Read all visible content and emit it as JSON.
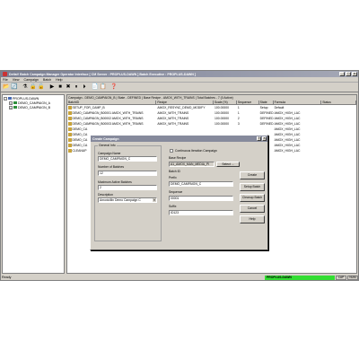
{
  "window": {
    "title": "DeltaV Batch Campaign Manager Operator Interface [ CM Server : PROPLUS-DAWN ] Batch Executive : PROPLUS-DAWN ]",
    "controls": [
      "_",
      "□",
      "×"
    ]
  },
  "menu": [
    "File",
    "View",
    "Campaign",
    "Batch",
    "Help"
  ],
  "toolbar": [
    "open-icon",
    "refresh-icon",
    "batch-icon",
    "lock-icon",
    "unlock-icon",
    "start-icon",
    "stop-icon",
    "cancel-icon",
    "pause-icon",
    "resume-icon",
    "copy-icon",
    "paste-icon",
    "help-icon"
  ],
  "tree": {
    "root": "PROPLUS-DAWN",
    "children": [
      "DEMO_CAMPAIGN_A",
      "DEMO_CAMPAIGN_B"
    ]
  },
  "campaign_line": "Campaign - DEMO_CAMPAIGN_B | State - DEFINED | Base Recipe - AMOX_WITH_TRAINS | Total Batches - 7 (0 Active)",
  "grid": {
    "headers": [
      "BatchID",
      "Recipe",
      "Scale (%)",
      "Sequence",
      "State",
      "Formula",
      "Status"
    ],
    "rows": [
      [
        "SETUP_FOR_CAMP_B",
        "AMOX_RESYNC_DEMO_MODIFY",
        "100.00000",
        "1",
        "Setup",
        "Default",
        ""
      ],
      [
        "DEMO_CAMPAIGN_B00001 AMOX_WITH_TRAINS",
        "AMOX_WITH_TRAINS",
        "100.00000",
        "1",
        "DEFINED",
        "AMOX_HIGH_LAC",
        ""
      ],
      [
        "DEMO_CAMPAIGN_B00002 AMOX_WITH_TRAINS",
        "AMOX_WITH_TRAINS",
        "100.00000",
        "2",
        "DEFINED",
        "AMOX_HIGH_LAC",
        ""
      ],
      [
        "DEMO_CAMPAIGN_B00003 AMOX_WITH_TRAINS",
        "AMOX_WITH_TRAINS",
        "100.00000",
        "3",
        "DEFINED",
        "AMOX_HIGH_LAC",
        ""
      ],
      [
        "DEMO_CA",
        "",
        "",
        "",
        "",
        "AMOX_HIGH_LAC",
        ""
      ],
      [
        "DEMO_CA",
        "",
        "",
        "",
        "",
        "AMOX_HIGH_LAC",
        ""
      ],
      [
        "DEMO_CA",
        "",
        "",
        "",
        "",
        "AMOX_HIGH_LAC",
        ""
      ],
      [
        "DEMO_CA",
        "",
        "",
        "",
        "",
        "AMOX_HIGH_LAC",
        ""
      ],
      [
        "CLEANUP",
        "",
        "",
        "",
        "",
        "AMOX_HIGH_LAC",
        ""
      ]
    ]
  },
  "status": {
    "ready": "Ready",
    "node": "PROPLUS-DAWN",
    "cap": "CAP",
    "num": "NUM"
  },
  "dialog": {
    "title": "Create Campaign",
    "controls": [
      "?",
      "×"
    ],
    "general_info": "General Info",
    "campaign_name_label": "Campaign Name",
    "campaign_name": "DEMO_CAMPAIGN_C",
    "number_batches_label": "Number of Batches",
    "number_batches": "12",
    "max_active_label": "Maximum Active Batches",
    "max_active": "2",
    "description_label": "Description",
    "description": "Amoxicillin Demo Campaign C",
    "continuous_label": "Continuous Iteration Campaign",
    "base_recipe_label": "Base Recipe",
    "base_recipe": "A1_AMOX_MAN_MEDIA_PI",
    "select_label": "Select ...",
    "batch_id_label": "Batch ID",
    "prefix_label": "Prefix",
    "prefix": "DEMO_CAMPAIGN_C",
    "sequence_label": "Sequence",
    "sequence": "00001",
    "suffix_label": "Suffix",
    "suffix": "ID123",
    "buttons": [
      "Create",
      "Setup Batch",
      "Cleanup Batch",
      "Cancel",
      "Help"
    ]
  }
}
